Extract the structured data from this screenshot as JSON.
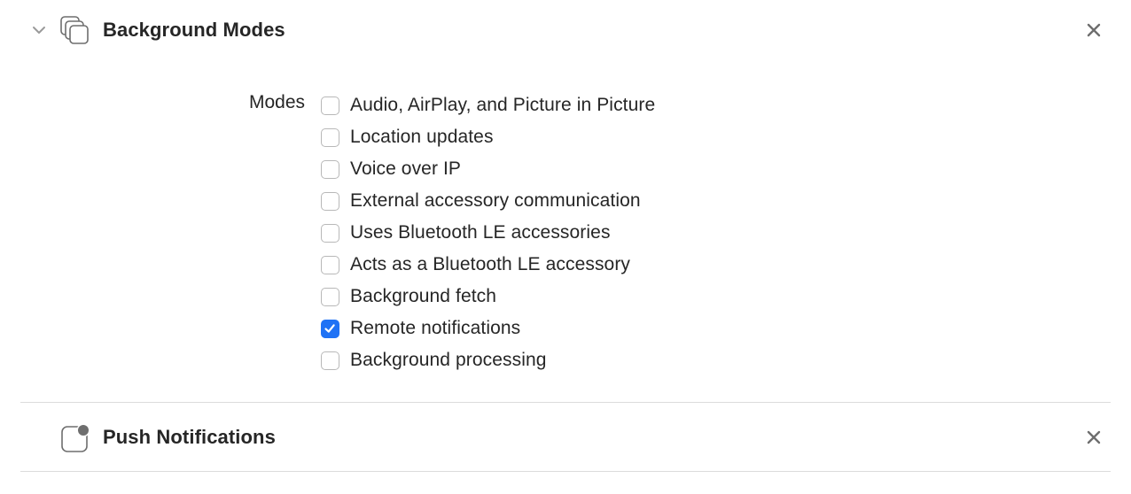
{
  "background_modes": {
    "title": "Background Modes",
    "modes_label": "Modes",
    "modes": [
      {
        "label": "Audio, AirPlay, and Picture in Picture",
        "checked": false
      },
      {
        "label": "Location updates",
        "checked": false
      },
      {
        "label": "Voice over IP",
        "checked": false
      },
      {
        "label": "External accessory communication",
        "checked": false
      },
      {
        "label": "Uses Bluetooth LE accessories",
        "checked": false
      },
      {
        "label": "Acts as a Bluetooth LE accessory",
        "checked": false
      },
      {
        "label": "Background fetch",
        "checked": false
      },
      {
        "label": "Remote notifications",
        "checked": true
      },
      {
        "label": "Background processing",
        "checked": false
      }
    ]
  },
  "push_notifications": {
    "title": "Push Notifications"
  },
  "colors": {
    "accent": "#1f72f5",
    "text": "#262626",
    "icon": "#6e6e6e",
    "divider": "#dcdcdc"
  },
  "icons": {
    "chevron": "chevron-down-icon",
    "background_modes": "stacked-windows-icon",
    "push_notifications": "push-badge-icon",
    "close": "close-icon"
  }
}
